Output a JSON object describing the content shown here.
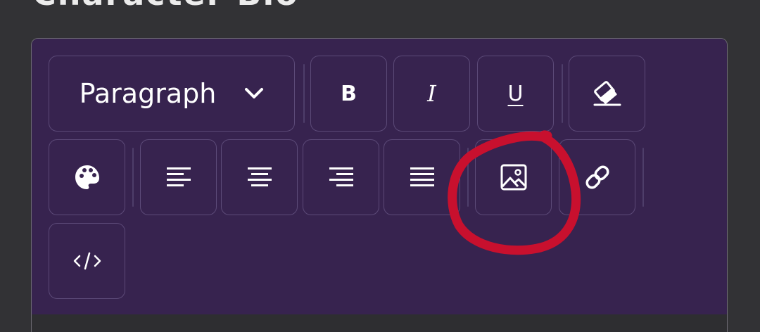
{
  "section": {
    "title": "Character Bio"
  },
  "toolbar": {
    "format_select": {
      "value": "Paragraph",
      "icon": "chevron-down-icon"
    },
    "bold_label": "B",
    "italic_label": "I",
    "underline_label": "U",
    "buttons": [
      {
        "name": "clear-format-button",
        "icon": "eraser-icon"
      },
      {
        "name": "text-color-button",
        "icon": "palette-icon"
      },
      {
        "name": "align-left-button",
        "icon": "align-left-icon"
      },
      {
        "name": "align-center-button",
        "icon": "align-center-icon"
      },
      {
        "name": "align-right-button",
        "icon": "align-right-icon"
      },
      {
        "name": "align-justify-button",
        "icon": "align-justify-icon"
      },
      {
        "name": "insert-image-button",
        "icon": "image-icon"
      },
      {
        "name": "insert-link-button",
        "icon": "link-icon"
      },
      {
        "name": "code-view-button",
        "icon": "code-icon"
      }
    ]
  },
  "annotation": {
    "type": "hand-drawn circle",
    "color": "#c8102e",
    "target": "insert-image-button"
  },
  "colors": {
    "page_background": "#323235",
    "toolbar_background": "#37234f",
    "button_border": "#5c4a78",
    "annotation": "#c8102e"
  }
}
